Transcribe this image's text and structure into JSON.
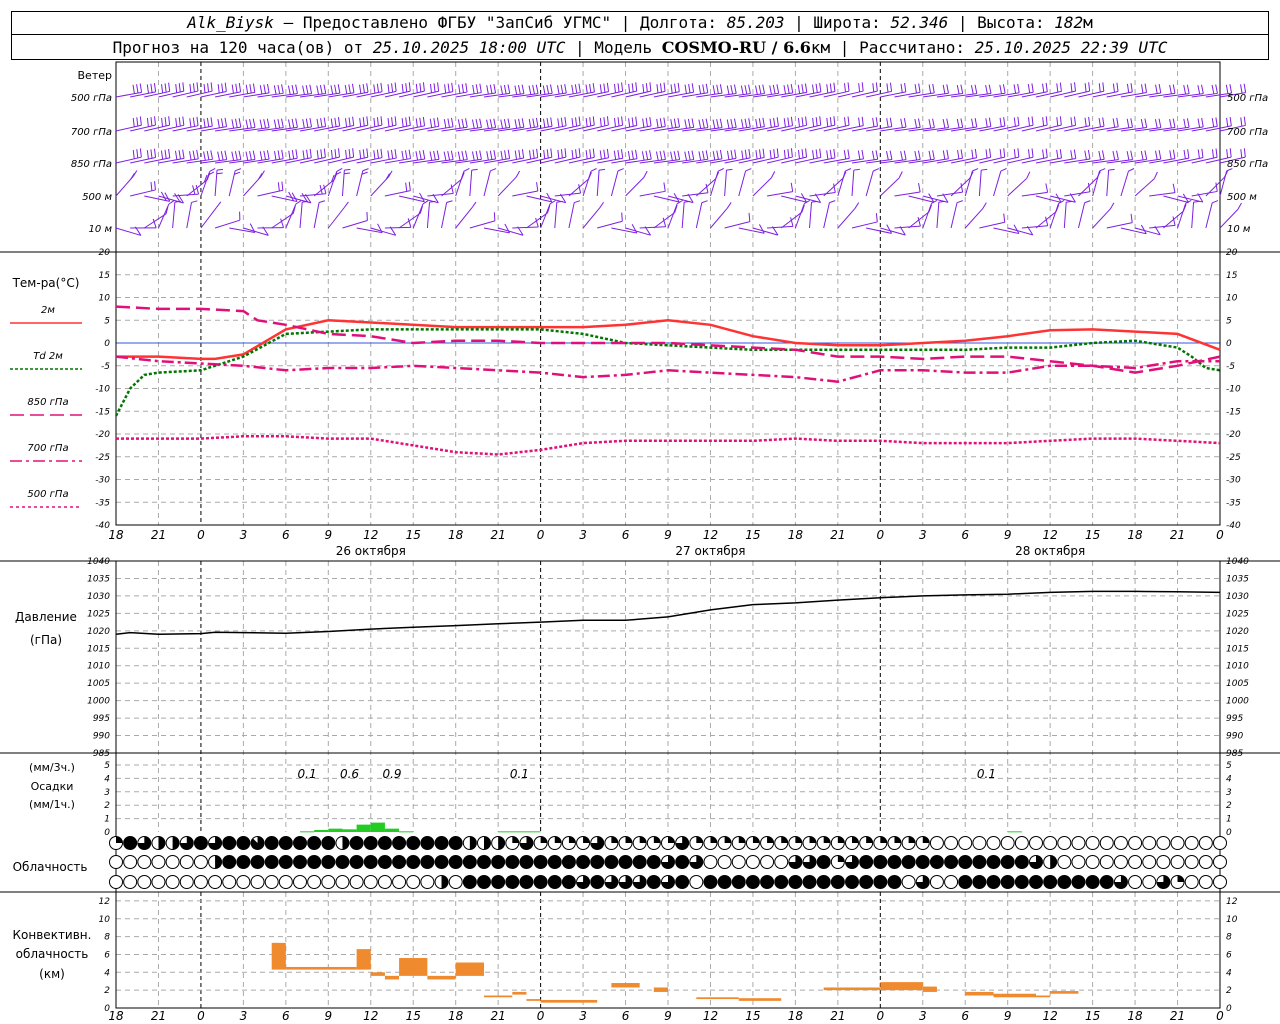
{
  "header": {
    "station": "Alk_Biysk",
    "provided": " — Предоставлено ФГБУ \"ЗапСиб УГМС\" | Долгота: ",
    "lon": "85.203",
    "lat_label": " | Широта: ",
    "lat": "52.346",
    "alt_label": " | Высота: ",
    "alt": "182",
    "alt_unit": "м",
    "forecast_label": "Прогноз на 120 часа(ов) от ",
    "init_time": "25.10.2025 18:00 UTC",
    "model_label": "  | Модель ",
    "model": "COSMO-RU / 6.6",
    "model_unit": "км",
    "calc_label": " | Рассчитано: ",
    "calc_time": "25.10.2025 22:39 UTC"
  },
  "wind_panel": {
    "title": "Ветер",
    "levels": [
      "500 гПа",
      "700 гПа",
      "850 гПа",
      "500 м",
      "10  м"
    ]
  },
  "temp_panel": {
    "title": "Тем-ра(°C)",
    "legend": [
      {
        "label": "2м",
        "color": "#ff3333",
        "dash": ""
      },
      {
        "label": "Td  2м",
        "color": "#007700",
        "dash": "3,2"
      },
      {
        "label": "850 гПа",
        "color": "#e0107a",
        "dash": "14,6"
      },
      {
        "label": "700 гПа",
        "color": "#e0107a",
        "dash": "12,4,3,4"
      },
      {
        "label": "500 гПа",
        "color": "#e0107a",
        "dash": "3,3"
      }
    ]
  },
  "pressure_panel": {
    "title": "Давление",
    "unit": "(гПа)"
  },
  "precip_panel": {
    "unit_3h": "(мм/3ч.)",
    "title": "Осадки",
    "unit_1h": "(мм/1ч.)"
  },
  "cloud_panel": {
    "title": "Облачность"
  },
  "conv_panel": {
    "title": "Конвективн.",
    "title2": "облачность",
    "unit": "(км)"
  },
  "x_axis": {
    "tick_labels": [
      "18",
      "21",
      "0",
      "3",
      "6",
      "9",
      "12",
      "15",
      "18",
      "21",
      "0",
      "3",
      "6",
      "9",
      "12",
      "15",
      "18",
      "21",
      "0",
      "3",
      "6",
      "9",
      "12",
      "15",
      "18",
      "21",
      "0"
    ],
    "days": [
      "26 октября",
      "27 октября",
      "28 октября"
    ]
  },
  "chart_data": [
    {
      "type": "line",
      "title": "Тем-ра(°C)",
      "x_unit": "hours from 25.10.2025 18:00 UTC",
      "xlim": [
        0,
        78
      ],
      "ylim": [
        -40,
        20
      ],
      "yticks": [
        20,
        15,
        10,
        5,
        0,
        -5,
        -10,
        -15,
        -20,
        -25,
        -30,
        -35,
        -40
      ],
      "series": [
        {
          "name": "2м",
          "x": [
            0,
            3,
            6,
            7,
            9,
            12,
            15,
            18,
            21,
            24,
            27,
            30,
            33,
            36,
            39,
            42,
            45,
            48,
            51,
            54,
            57,
            60,
            63,
            66,
            69,
            72,
            75,
            78
          ],
          "y": [
            -3,
            -3,
            -3.5,
            -3.5,
            -2.5,
            3,
            5,
            4.5,
            4,
            3.5,
            3.5,
            3.5,
            3.5,
            4,
            5,
            4,
            1.5,
            0,
            -0.5,
            -0.5,
            0,
            0.5,
            1.5,
            2.8,
            3,
            2.5,
            2,
            -1.5
          ]
        },
        {
          "name": "Td  2м",
          "x": [
            0,
            1,
            2,
            3,
            6,
            9,
            12,
            15,
            18,
            21,
            24,
            27,
            30,
            33,
            36,
            39,
            42,
            45,
            48,
            51,
            54,
            57,
            60,
            63,
            66,
            69,
            72,
            75,
            76,
            77,
            78
          ],
          "y": [
            -16,
            -10,
            -7,
            -6.5,
            -6,
            -3,
            2,
            2.5,
            3,
            3,
            3,
            3,
            3,
            2,
            0,
            -0.5,
            -1,
            -1.5,
            -1.5,
            -1.5,
            -1.5,
            -1.5,
            -1.5,
            -1,
            -1,
            0,
            0.5,
            -1,
            -3,
            -5.5,
            -6
          ]
        },
        {
          "name": "850 гПа",
          "x": [
            0,
            3,
            6,
            9,
            10,
            12,
            15,
            18,
            21,
            24,
            27,
            30,
            33,
            36,
            39,
            42,
            45,
            48,
            51,
            54,
            57,
            60,
            63,
            66,
            69,
            72,
            75,
            78
          ],
          "y": [
            8,
            7.5,
            7.5,
            7,
            5,
            4,
            2,
            1.5,
            0,
            0.5,
            0.5,
            0,
            0,
            0,
            0,
            -0.5,
            -1,
            -1.5,
            -3,
            -3,
            -3.5,
            -3,
            -3,
            -4,
            -5,
            -6.5,
            -5,
            -3
          ]
        },
        {
          "name": "700 гПа",
          "x": [
            0,
            3,
            6,
            9,
            12,
            15,
            18,
            21,
            24,
            27,
            30,
            33,
            36,
            39,
            42,
            45,
            48,
            51,
            54,
            57,
            60,
            63,
            66,
            69,
            72,
            75,
            78
          ],
          "y": [
            -3,
            -4,
            -4.5,
            -5,
            -6,
            -5.5,
            -5.5,
            -5,
            -5.5,
            -6,
            -6.5,
            -7.5,
            -7,
            -6,
            -6.5,
            -7,
            -7.5,
            -8.5,
            -6,
            -6,
            -6.5,
            -6.5,
            -5,
            -5,
            -5.5,
            -4,
            -4
          ]
        },
        {
          "name": "500 гПа",
          "x": [
            0,
            3,
            6,
            9,
            12,
            15,
            18,
            21,
            24,
            27,
            30,
            33,
            36,
            39,
            42,
            45,
            48,
            51,
            54,
            57,
            60,
            63,
            66,
            69,
            72,
            75,
            78
          ],
          "y": [
            -21,
            -21,
            -21,
            -20.5,
            -20.5,
            -21,
            -21,
            -22.5,
            -24,
            -24.5,
            -23.5,
            -22,
            -21.5,
            -21.5,
            -21.5,
            -21.5,
            -21,
            -21.5,
            -21.5,
            -22,
            -22,
            -22,
            -21.5,
            -21,
            -21,
            -21.5,
            -22
          ]
        }
      ]
    },
    {
      "type": "line",
      "title": "Давление",
      "ylabel": "(гПа)",
      "ylim": [
        985,
        1040
      ],
      "yticks": [
        1040,
        1035,
        1030,
        1025,
        1020,
        1015,
        1010,
        1005,
        1000,
        995,
        990,
        985
      ],
      "series": [
        {
          "name": "",
          "x": [
            0,
            1,
            3,
            6,
            7,
            9,
            12,
            15,
            18,
            21,
            24,
            27,
            30,
            33,
            36,
            39,
            42,
            45,
            48,
            51,
            54,
            57,
            60,
            63,
            66,
            69,
            72,
            75,
            78
          ],
          "y": [
            1019,
            1019.5,
            1019,
            1019.2,
            1019.6,
            1019.5,
            1019.3,
            1019.8,
            1020.5,
            1021,
            1021.5,
            1022,
            1022.5,
            1023,
            1023,
            1024,
            1026,
            1027.5,
            1028,
            1028.8,
            1029.5,
            1030,
            1030.3,
            1030.5,
            1031,
            1031.3,
            1031.3,
            1031.2,
            1031
          ]
        }
      ]
    },
    {
      "type": "bar",
      "title": "Осадки",
      "ylabel": "(мм/1ч.)",
      "ylim": [
        0,
        5
      ],
      "yticks": [
        5,
        4,
        3,
        2,
        1,
        0
      ],
      "series": [
        {
          "name": "",
          "x": [
            13,
            14,
            15,
            16,
            17,
            18,
            19,
            20,
            27,
            28,
            29,
            63
          ],
          "y": [
            0.05,
            0.15,
            0.25,
            0.2,
            0.55,
            0.7,
            0.25,
            0.05,
            0.05,
            0.05,
            0.05,
            0.05
          ]
        }
      ],
      "annotations": [
        {
          "x": 13.5,
          "text": "0.1"
        },
        {
          "x": 16.5,
          "text": "0.6"
        },
        {
          "x": 19.5,
          "text": "0.9"
        },
        {
          "x": 28.5,
          "text": "0.1"
        },
        {
          "x": 61.5,
          "text": "0.1"
        }
      ]
    },
    {
      "type": "bar",
      "title": "Конвективн. облачность",
      "ylabel": "(км)",
      "ylim": [
        0,
        13
      ],
      "yticks": [
        12,
        10,
        8,
        6,
        4,
        2,
        0
      ],
      "cells": [
        {
          "x0": 11,
          "x1": 12,
          "base": 4.3,
          "top": 7.3
        },
        {
          "x0": 12,
          "x1": 17,
          "base": 4.3,
          "top": 4.6
        },
        {
          "x0": 17,
          "x1": 18,
          "base": 4.3,
          "top": 6.6
        },
        {
          "x0": 18,
          "x1": 19,
          "base": 3.6,
          "top": 4.0
        },
        {
          "x0": 19,
          "x1": 20,
          "base": 3.2,
          "top": 3.6
        },
        {
          "x0": 20,
          "x1": 22,
          "base": 3.6,
          "top": 5.6
        },
        {
          "x0": 22,
          "x1": 24,
          "base": 3.2,
          "top": 3.6
        },
        {
          "x0": 24,
          "x1": 26,
          "base": 3.6,
          "top": 5.1
        },
        {
          "x0": 26,
          "x1": 28,
          "base": 1.2,
          "top": 1.4
        },
        {
          "x0": 28,
          "x1": 29,
          "base": 1.5,
          "top": 1.8
        },
        {
          "x0": 29,
          "x1": 30,
          "base": 0.8,
          "top": 1.0
        },
        {
          "x0": 30,
          "x1": 34,
          "base": 0.6,
          "top": 0.9
        },
        {
          "x0": 35,
          "x1": 37,
          "base": 2.3,
          "top": 2.8
        },
        {
          "x0": 38,
          "x1": 39,
          "base": 1.8,
          "top": 2.3
        },
        {
          "x0": 41,
          "x1": 44,
          "base": 1.0,
          "top": 1.2
        },
        {
          "x0": 44,
          "x1": 47,
          "base": 0.8,
          "top": 1.1
        },
        {
          "x0": 50,
          "x1": 54,
          "base": 2.0,
          "top": 2.3
        },
        {
          "x0": 54,
          "x1": 57,
          "base": 2.0,
          "top": 2.9
        },
        {
          "x0": 57,
          "x1": 58,
          "base": 1.8,
          "top": 2.4
        },
        {
          "x0": 60,
          "x1": 62,
          "base": 1.4,
          "top": 1.8
        },
        {
          "x0": 62,
          "x1": 65,
          "base": 1.2,
          "top": 1.6
        },
        {
          "x0": 65,
          "x1": 66,
          "base": 1.2,
          "top": 1.4
        },
        {
          "x0": 66,
          "x1": 68,
          "base": 1.6,
          "top": 1.9
        }
      ]
    }
  ],
  "cloud_rows": {
    "note": "cloud cover in oktas per hour, top row = upper, middle, lower",
    "upper": [
      2,
      8,
      6,
      4,
      4,
      6,
      8,
      6,
      8,
      8,
      7,
      8,
      8,
      8,
      8,
      8,
      4,
      8,
      8,
      8,
      8,
      8,
      8,
      8,
      8,
      4,
      4,
      4,
      2,
      6,
      2,
      2,
      2,
      2,
      6,
      2,
      2,
      2,
      2,
      2,
      6,
      2,
      2,
      2,
      2,
      2,
      2,
      2,
      2,
      2,
      2,
      2,
      2,
      2,
      2,
      2,
      2,
      2,
      0,
      0,
      0,
      0,
      0,
      0,
      0,
      0,
      0,
      0,
      0,
      0,
      0,
      0,
      0,
      0,
      0,
      0,
      0,
      0,
      0
    ],
    "middle": [
      0,
      0,
      0,
      0,
      0,
      0,
      0,
      4,
      8,
      8,
      8,
      8,
      8,
      8,
      8,
      8,
      8,
      8,
      8,
      8,
      8,
      8,
      8,
      8,
      8,
      8,
      8,
      8,
      8,
      8,
      8,
      8,
      8,
      8,
      8,
      8,
      8,
      8,
      8,
      6,
      8,
      6,
      0,
      0,
      0,
      0,
      0,
      0,
      6,
      6,
      8,
      2,
      6,
      8,
      8,
      8,
      8,
      8,
      8,
      8,
      8,
      8,
      8,
      8,
      8,
      6,
      4,
      0,
      0,
      0,
      0,
      0,
      0,
      0,
      0,
      0,
      0,
      0,
      0
    ],
    "lower": [
      0,
      0,
      0,
      0,
      0,
      0,
      0,
      0,
      0,
      0,
      0,
      0,
      0,
      0,
      0,
      0,
      0,
      0,
      0,
      0,
      0,
      0,
      0,
      4,
      0,
      8,
      8,
      8,
      8,
      8,
      8,
      8,
      8,
      6,
      8,
      6,
      6,
      6,
      8,
      6,
      8,
      0,
      8,
      8,
      8,
      8,
      8,
      8,
      8,
      8,
      8,
      8,
      8,
      8,
      8,
      8,
      0,
      6,
      0,
      0,
      8,
      8,
      8,
      8,
      8,
      8,
      8,
      8,
      8,
      8,
      8,
      6,
      0,
      0,
      6,
      2,
      0,
      0,
      0
    ]
  },
  "colors": {
    "wind": "#7d1fe0",
    "temp2m": "#ff3333",
    "td": "#007700",
    "upper": "#e0107a",
    "precip": "#22cc22",
    "conv": "#f08a2e",
    "zero": "#3355dd"
  }
}
